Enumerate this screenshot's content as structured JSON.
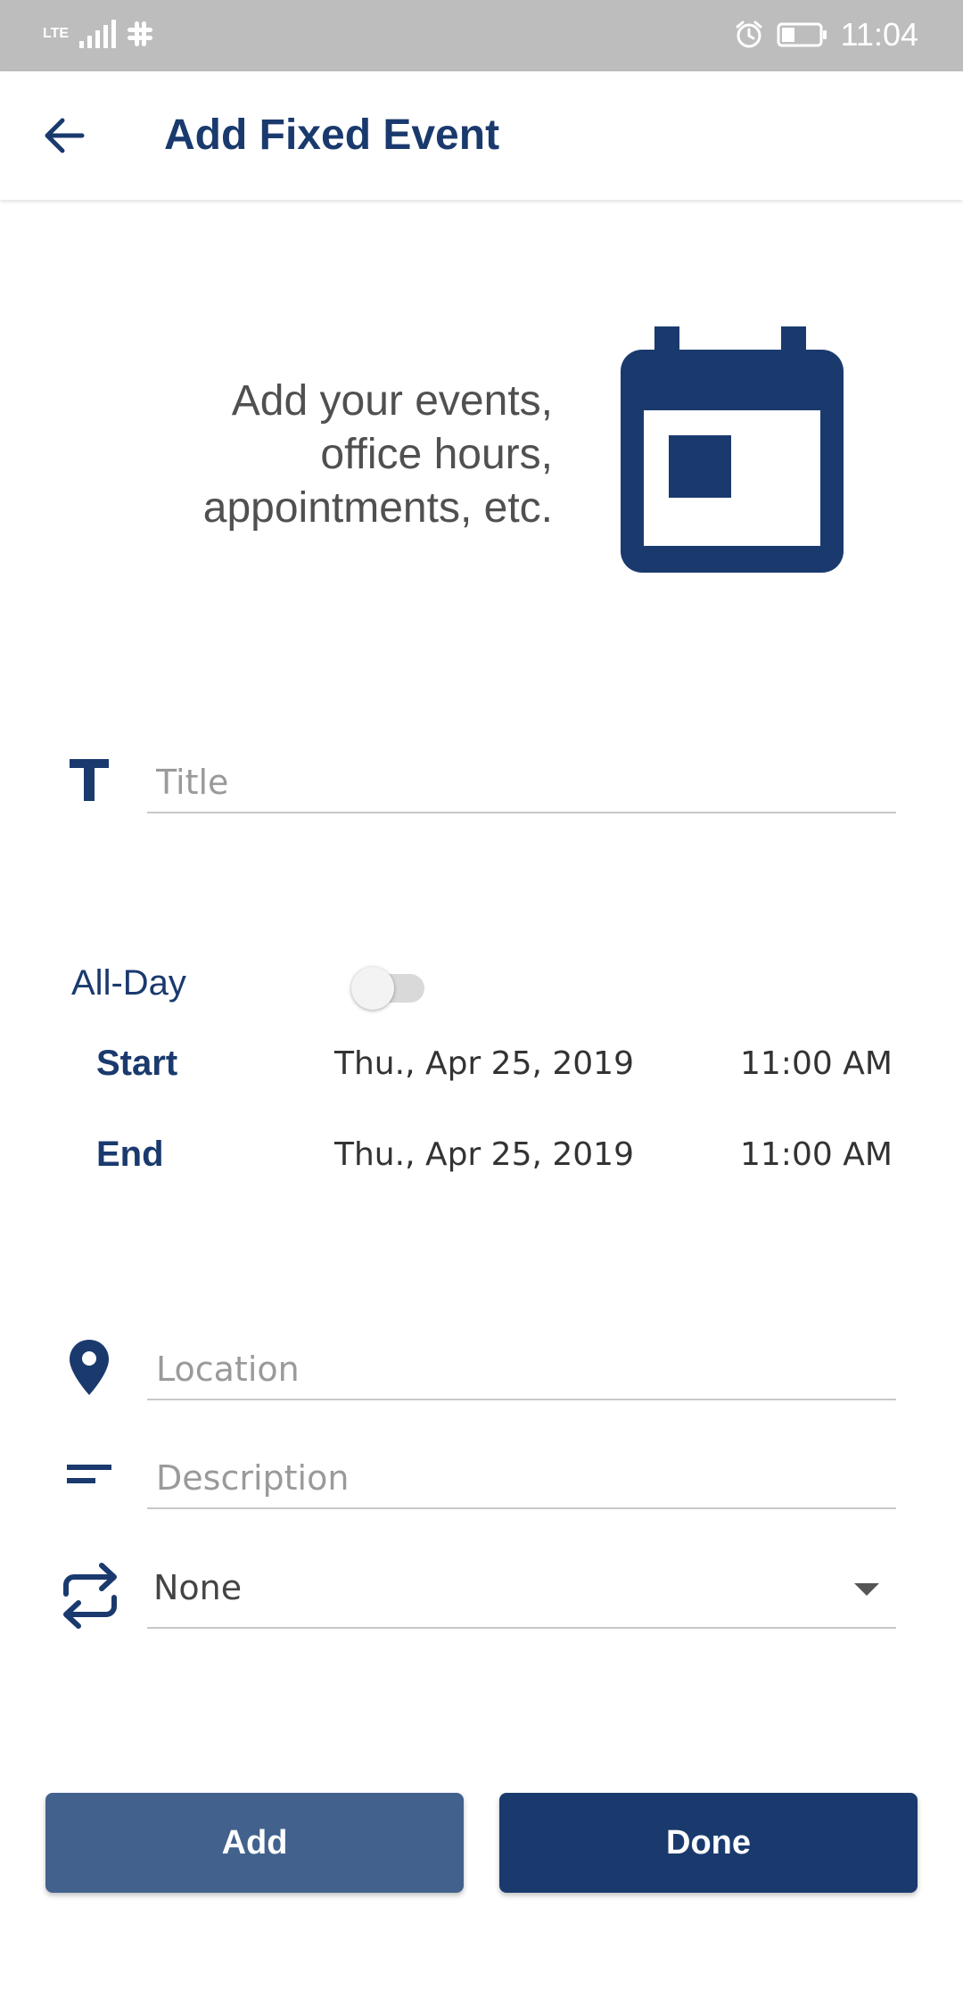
{
  "colors": {
    "brand": "#1a3a6e",
    "button_secondary": "#42628d"
  },
  "status_bar": {
    "time": "11:04",
    "network": "LTE"
  },
  "appbar": {
    "title": "Add Fixed Event"
  },
  "hero": {
    "line1": "Add your events,",
    "line2": "office hours,",
    "line3": "appointments, etc."
  },
  "form": {
    "title": {
      "placeholder": "Title",
      "value": ""
    },
    "all_day": {
      "label": "All-Day",
      "checked": false
    },
    "start": {
      "label": "Start",
      "date": "Thu., Apr 25, 2019",
      "time": "11:00 AM"
    },
    "end": {
      "label": "End",
      "date": "Thu., Apr 25, 2019",
      "time": "11:00 AM"
    },
    "location": {
      "placeholder": "Location",
      "value": ""
    },
    "description": {
      "placeholder": "Description",
      "value": ""
    },
    "repeat": {
      "selected": "None"
    }
  },
  "buttons": {
    "add": "Add",
    "done": "Done"
  }
}
